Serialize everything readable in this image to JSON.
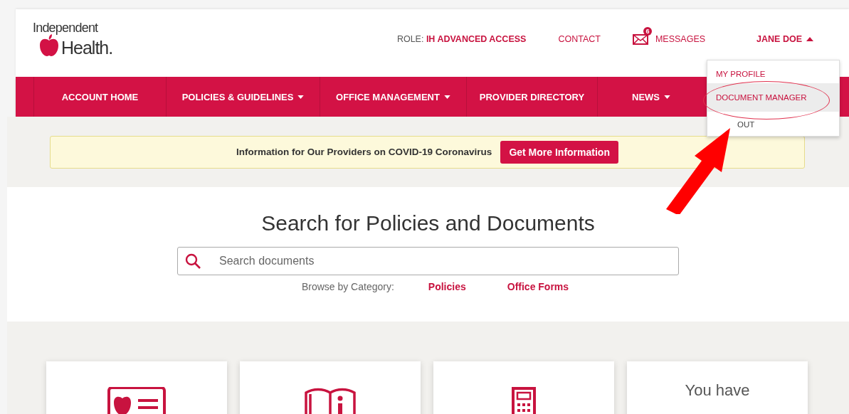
{
  "logo": {
    "line1": "Independent",
    "line2": "Health."
  },
  "utility_nav": {
    "role_label": "ROLE:",
    "role_value": "IH ADVANCED ACCESS",
    "contact": "CONTACT",
    "messages": {
      "label": "MESSAGES",
      "badge": "6"
    },
    "user": {
      "name": "JANE DOE",
      "expanded": true
    }
  },
  "user_menu": [
    {
      "label": "MY PROFILE",
      "selected": false
    },
    {
      "label": "DOCUMENT MANAGER",
      "selected": true
    },
    {
      "label": "OUT",
      "selected": false
    }
  ],
  "nav": [
    {
      "label": "ACCOUNT HOME",
      "dropdown": false
    },
    {
      "label": "POLICIES & GUIDELINES",
      "dropdown": true
    },
    {
      "label": "OFFICE MANAGEMENT",
      "dropdown": true
    },
    {
      "label": "PROVIDER DIRECTORY",
      "dropdown": false
    },
    {
      "label": "NEWS",
      "dropdown": true
    }
  ],
  "banner": {
    "text": "Information for Our Providers on COVID-19 Coronavirus",
    "button": "Get More Information"
  },
  "search": {
    "title": "Search for Policies and Documents",
    "placeholder": "Search documents",
    "browse_label": "Browse by Category:",
    "categories": [
      "Policies",
      "Office Forms"
    ]
  },
  "cards": [
    {
      "kind": "id-card"
    },
    {
      "kind": "book"
    },
    {
      "kind": "calculator"
    },
    {
      "kind": "text",
      "text": "You have"
    }
  ],
  "annotations": {
    "highlight_ellipse": true,
    "arrow": true
  }
}
